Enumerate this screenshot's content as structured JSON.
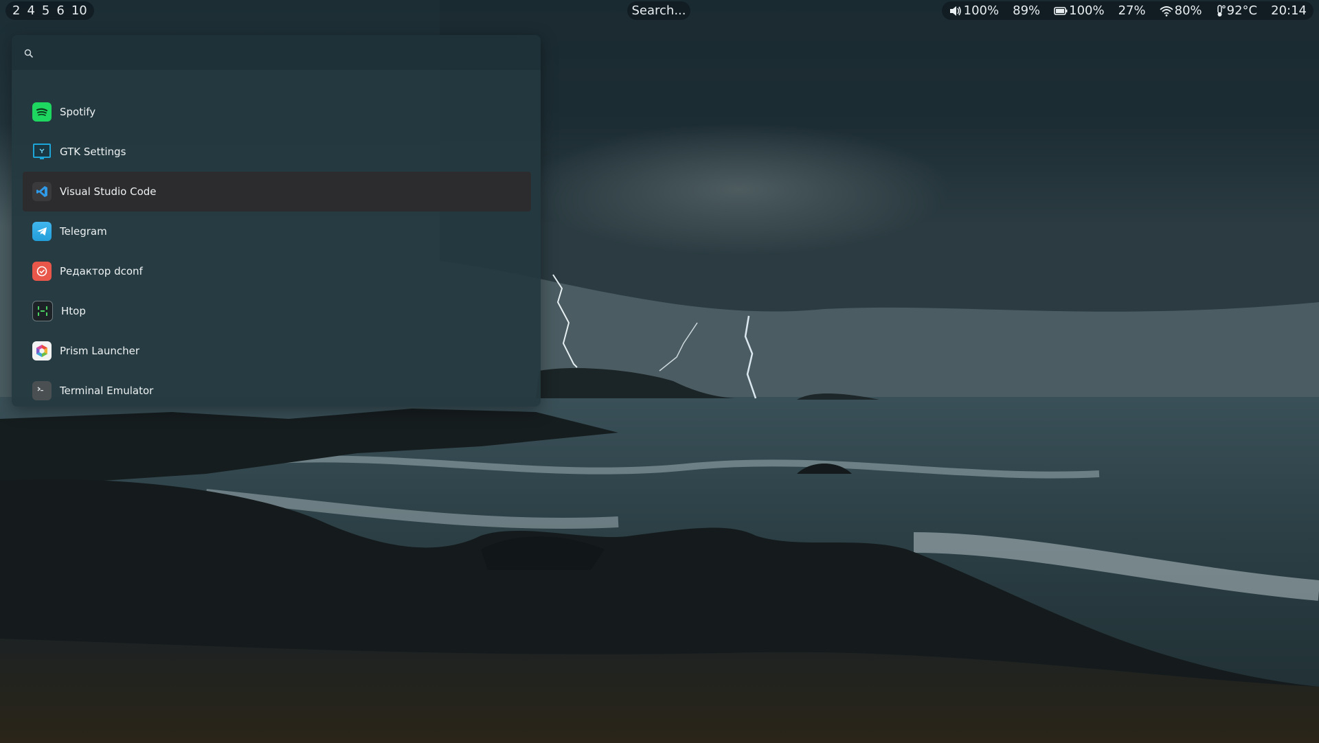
{
  "workspaces": [
    "2",
    "4",
    "5",
    "6",
    "10"
  ],
  "search_button": "Search...",
  "status": {
    "volume": "100%",
    "cpu": "89%",
    "battery": "100%",
    "memory": "27%",
    "wifi": "80%",
    "temperature": "92°C",
    "clock": "20:14"
  },
  "launcher": {
    "query": "",
    "apps": [
      {
        "label": "Spotify",
        "icon": "spotify-icon"
      },
      {
        "label": "GTK Settings",
        "icon": "gtk-settings-icon"
      },
      {
        "label": "Visual Studio Code",
        "icon": "vscode-icon",
        "selected": true
      },
      {
        "label": "Telegram",
        "icon": "telegram-icon"
      },
      {
        "label": "Редактор dconf",
        "icon": "dconf-editor-icon"
      },
      {
        "label": "Htop",
        "icon": "htop-icon"
      },
      {
        "label": "Prism Launcher",
        "icon": "prism-launcher-icon"
      },
      {
        "label": "Terminal Emulator",
        "icon": "terminal-icon"
      }
    ]
  },
  "colors": {
    "bar_bg": "#0e181e",
    "launcher_bg": "#243940",
    "selected_bg": "#2c2c2e",
    "text": "#eef2f3"
  }
}
